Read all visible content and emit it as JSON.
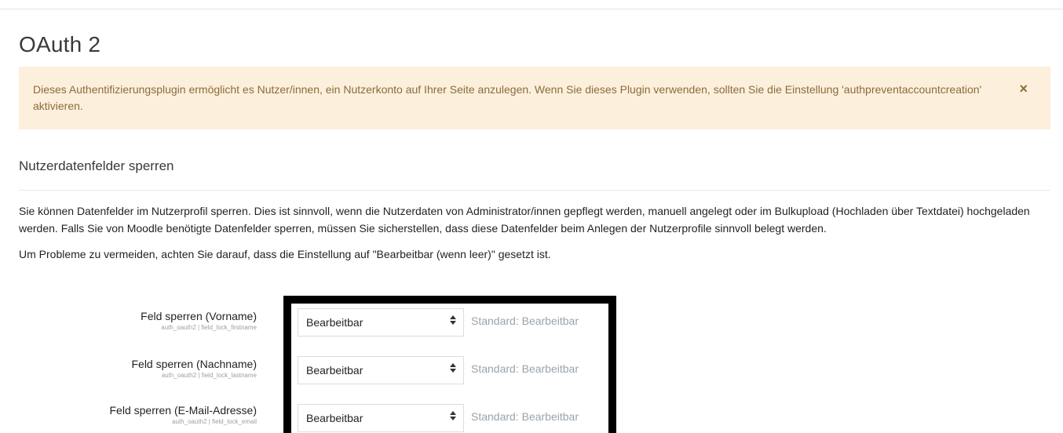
{
  "page": {
    "title": "OAuth 2"
  },
  "alert": {
    "message": "Dieses Authentifizierungsplugin ermöglicht es Nutzer/innen, ein Nutzerkonto auf Ihrer Seite anzulegen. Wenn Sie dieses Plugin verwenden, sollten Sie die Einstellung 'authpreventaccountcreation' aktivieren.",
    "close_glyph": "×",
    "background": "#fcefdc",
    "text_color": "#8a6d3b"
  },
  "section": {
    "heading": "Nutzerdatenfelder sperren",
    "description_1": "Sie können Datenfelder im Nutzerprofil sperren. Dies ist sinnvoll, wenn die Nutzerdaten von Administrator/innen gepflegt werden, manuell angelegt oder im Bulkupload (Hochladen über Textdatei) hochgeladen werden. Falls Sie von Moodle benötigte Datenfelder sperren, müssen Sie sicherstellen, dass diese Datenfelder beim Anlegen der Nutzerprofile sinnvoll belegt werden.",
    "description_2": "Um Probleme zu vermeiden, achten Sie darauf, dass die Einstellung auf \"Bearbeitbar (wenn leer)\" gesetzt ist."
  },
  "settings": [
    {
      "label": "Feld sperren (Vorname)",
      "key": "auth_oauth2 | field_lock_firstname",
      "value": "Bearbeitbar",
      "default": "Standard: Bearbeitbar"
    },
    {
      "label": "Feld sperren (Nachname)",
      "key": "auth_oauth2 | field_lock_lastname",
      "value": "Bearbeitbar",
      "default": "Standard: Bearbeitbar"
    },
    {
      "label": "Feld sperren (E-Mail-Adresse)",
      "key": "auth_oauth2 | field_lock_email",
      "value": "Bearbeitbar",
      "default": "Standard: Bearbeitbar"
    }
  ],
  "icons": {
    "select_arrow": "sort-arrows-icon",
    "alert_close": "close-icon"
  }
}
